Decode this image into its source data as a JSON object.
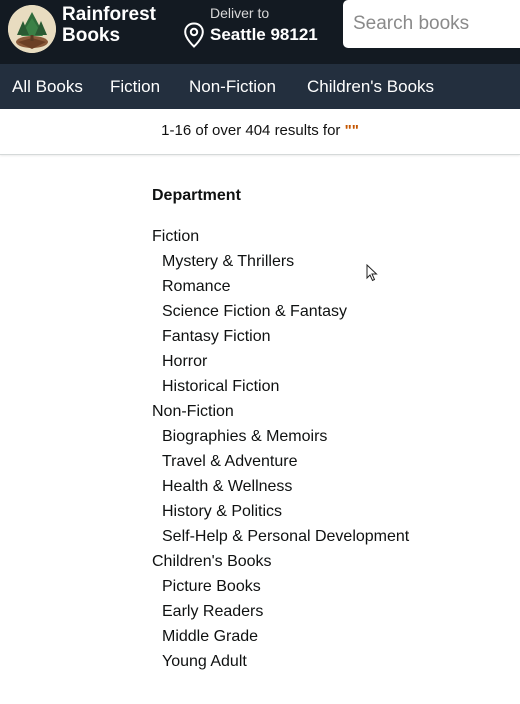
{
  "header": {
    "brand_line1": "Rainforest",
    "brand_line2": "Books",
    "deliver_label": "Deliver to",
    "deliver_location": "Seattle 98121",
    "search_placeholder": "Search books"
  },
  "nav": {
    "items": [
      "All Books",
      "Fiction",
      "Non-Fiction",
      "Children's Books"
    ]
  },
  "results": {
    "summary": "1-16 of over 404 results for",
    "query": "\"\""
  },
  "filters": {
    "heading": "Department",
    "categories": [
      {
        "label": "Fiction",
        "children": [
          "Mystery & Thrillers",
          "Romance",
          "Science Fiction & Fantasy",
          "Fantasy Fiction",
          "Horror",
          "Historical Fiction"
        ]
      },
      {
        "label": "Non-Fiction",
        "children": [
          "Biographies & Memoirs",
          "Travel & Adventure",
          "Health & Wellness",
          "History & Politics",
          "Self-Help & Personal Development"
        ]
      },
      {
        "label": "Children's Books",
        "children": [
          "Picture Books",
          "Early Readers",
          "Middle Grade",
          "Young Adult"
        ]
      }
    ]
  },
  "colors": {
    "header_bg": "#131a22",
    "nav_bg": "#232f3e",
    "query_accent": "#c45500"
  }
}
